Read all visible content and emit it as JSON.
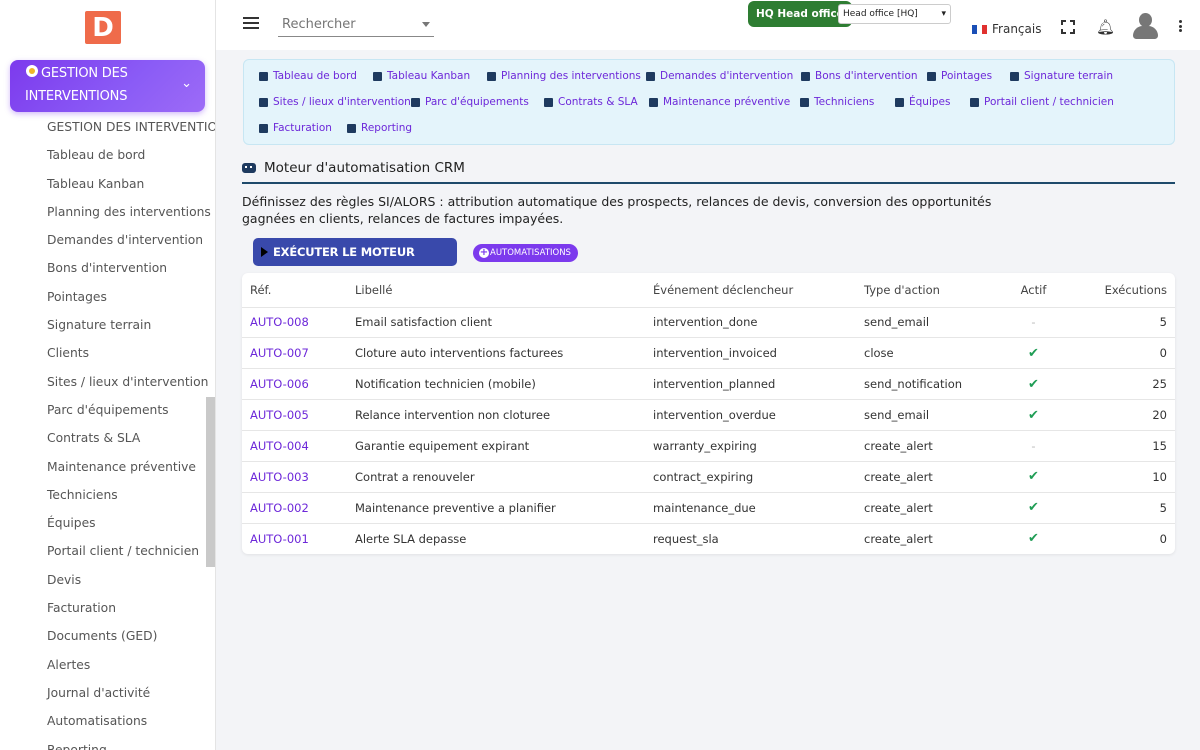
{
  "brand": {
    "logo_letter": "D"
  },
  "sidebar": {
    "module_title": "GESTION DES INTERVENTIONS",
    "items": [
      {
        "label": "GESTION DES INTERVENTIONS"
      },
      {
        "label": "Tableau de bord"
      },
      {
        "label": "Tableau Kanban"
      },
      {
        "label": "Planning des interventions"
      },
      {
        "label": "Demandes d'intervention"
      },
      {
        "label": "Bons d'intervention"
      },
      {
        "label": "Pointages"
      },
      {
        "label": "Signature terrain"
      },
      {
        "label": "Clients"
      },
      {
        "label": "Sites / lieux d'intervention"
      },
      {
        "label": "Parc d'équipements"
      },
      {
        "label": "Contrats & SLA"
      },
      {
        "label": "Maintenance préventive"
      },
      {
        "label": "Techniciens"
      },
      {
        "label": "Équipes"
      },
      {
        "label": "Portail client / technicien"
      },
      {
        "label": "Devis"
      },
      {
        "label": "Facturation"
      },
      {
        "label": "Documents (GED)"
      },
      {
        "label": "Alertes"
      },
      {
        "label": "Journal d'activité"
      },
      {
        "label": "Automatisations"
      },
      {
        "label": "Reporting"
      }
    ]
  },
  "header": {
    "search_placeholder": "Rechercher",
    "hq_badge": "HQ Head office",
    "office_select": "Head office [HQ]",
    "language": "Français"
  },
  "quicknav": [
    {
      "label": "Tableau de bord",
      "icon": "grid-icon"
    },
    {
      "label": "Tableau Kanban",
      "icon": "kanban-icon"
    },
    {
      "label": "Planning des interventions",
      "icon": "calendar-icon"
    },
    {
      "label": "Demandes d'intervention",
      "icon": "headset-icon"
    },
    {
      "label": "Bons d'intervention",
      "icon": "tools-icon"
    },
    {
      "label": "Pointages",
      "icon": "clock-icon"
    },
    {
      "label": "Signature terrain",
      "icon": "signature-icon"
    },
    {
      "label": "Sites / lieux d'intervention",
      "icon": "map-pin-icon"
    },
    {
      "label": "Parc d'équipements",
      "icon": "cogs-icon"
    },
    {
      "label": "Contrats & SLA",
      "icon": "contract-icon"
    },
    {
      "label": "Maintenance préventive",
      "icon": "calendar-check-icon"
    },
    {
      "label": "Techniciens",
      "icon": "user-cog-icon"
    },
    {
      "label": "Équipes",
      "icon": "users-icon"
    },
    {
      "label": "Portail client / technicien",
      "icon": "mobile-icon"
    },
    {
      "label": "Facturation",
      "icon": "invoice-icon"
    },
    {
      "label": "Reporting",
      "icon": "pie-chart-icon"
    }
  ],
  "main": {
    "title": "Moteur d'automatisation CRM",
    "description": "Définissez des règles SI/ALORS : attribution automatique des prospects, relances de devis, conversion des opportunités gagnées en clients, relances de factures impayées.",
    "run_button": "EXÉCUTER LE MOTEUR MAINTENANT",
    "automations_button": "AUTOMATISATIONS"
  },
  "table": {
    "headers": {
      "ref": "Réf.",
      "label": "Libellé",
      "event": "Événement déclencheur",
      "action": "Type d'action",
      "active": "Actif",
      "runs": "Exécutions"
    },
    "rows": [
      {
        "ref": "AUTO-008",
        "label": "Email satisfaction client",
        "event": "intervention_done",
        "action": "send_email",
        "active": "-",
        "runs": "5"
      },
      {
        "ref": "AUTO-007",
        "label": "Cloture auto interventions facturees",
        "event": "intervention_invoiced",
        "action": "close",
        "active": "✔",
        "runs": "0"
      },
      {
        "ref": "AUTO-006",
        "label": "Notification technicien (mobile)",
        "event": "intervention_planned",
        "action": "send_notification",
        "active": "✔",
        "runs": "25"
      },
      {
        "ref": "AUTO-005",
        "label": "Relance intervention non cloturee",
        "event": "intervention_overdue",
        "action": "send_email",
        "active": "✔",
        "runs": "20"
      },
      {
        "ref": "AUTO-004",
        "label": "Garantie equipement expirant",
        "event": "warranty_expiring",
        "action": "create_alert",
        "active": "-",
        "runs": "15"
      },
      {
        "ref": "AUTO-003",
        "label": "Contrat a renouveler",
        "event": "contract_expiring",
        "action": "create_alert",
        "active": "✔",
        "runs": "10"
      },
      {
        "ref": "AUTO-002",
        "label": "Maintenance preventive a planifier",
        "event": "maintenance_due",
        "action": "create_alert",
        "active": "✔",
        "runs": "5"
      },
      {
        "ref": "AUTO-001",
        "label": "Alerte SLA depasse",
        "event": "request_sla",
        "action": "create_alert",
        "active": "✔",
        "runs": "0"
      }
    ]
  }
}
